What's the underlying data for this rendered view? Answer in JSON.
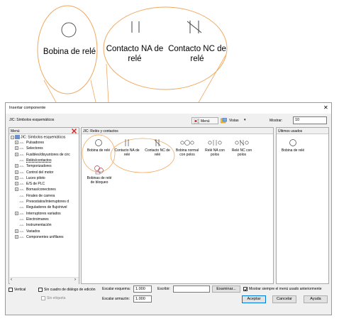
{
  "callouts": {
    "coil": "Bobina de relé",
    "no_contact": "Contacto NA de relé",
    "nc_contact": "Contacto NC de relé"
  },
  "dialog": {
    "title": "Insertar componente",
    "close_glyph": "✕",
    "path_label": "JIC: Símbolos esquemáticos",
    "toolbar": {
      "menu_label": "Menú",
      "views_label": "Vistas",
      "show_label": "Mostrar:",
      "show_value": "10"
    },
    "left_panel": {
      "header": "Menú",
      "root": "JIC: Símbolos esquemáticos",
      "items": [
        {
          "label": "Pulsadores",
          "expandable": true
        },
        {
          "label": "Selectores",
          "expandable": true
        },
        {
          "label": "Fusibles/disyuntores de circ",
          "expandable": true
        },
        {
          "label": "Relés/contactos",
          "expandable": false,
          "selected": true
        },
        {
          "label": "Temporizadores",
          "expandable": true
        },
        {
          "label": "Control del motor",
          "expandable": true
        },
        {
          "label": "Luces piloto",
          "expandable": true
        },
        {
          "label": "E/S de PLC",
          "expandable": true
        },
        {
          "label": "Bornas/conectores",
          "expandable": true
        },
        {
          "label": "Finales de carrera",
          "expandable": false
        },
        {
          "label": "Presostatos/interruptores d",
          "expandable": false
        },
        {
          "label": "Reguladores de flujo/nivel",
          "expandable": false
        },
        {
          "label": "Interruptores variados",
          "expandable": true
        },
        {
          "label": "Electroimanes",
          "expandable": false
        },
        {
          "label": "Instrumentación",
          "expandable": false
        },
        {
          "label": "Variados",
          "expandable": true
        },
        {
          "label": "Componentes unifilares",
          "expandable": true
        }
      ]
    },
    "center_panel": {
      "header": "JIC: Relés y contactos",
      "components": [
        {
          "label": "Bobina de relé",
          "icon": "coil-icon"
        },
        {
          "label": "Contacto NA de relé",
          "icon": "no-contact-icon"
        },
        {
          "label": "Contacto NC de relé",
          "icon": "nc-contact-icon"
        },
        {
          "label": "Bobina normal con polos",
          "icon": "coil-poles-icon"
        },
        {
          "label": "Relé NA con polos",
          "icon": "no-poles-icon"
        },
        {
          "label": "Relé NC con polos",
          "icon": "nc-poles-icon"
        },
        {
          "label": "Bobinas de relé de bloqueo",
          "icon": "latch-coil-icon"
        }
      ]
    },
    "right_panel": {
      "header": "Últimos usados",
      "items": [
        {
          "label": "Bobina de relé"
        }
      ]
    },
    "bottom": {
      "vertical": "Vertical",
      "no_edit_dialog": "Sin cuadro de diálogo de edición",
      "no_tags": "Sin etiqueta",
      "scale_schematic_label": "Escalar esquema:",
      "scale_schematic_value": "1.000",
      "scale_frame_label": "Escalar armazón:",
      "scale_frame_value": "1.000",
      "write_label": "Escribir:",
      "write_value": "",
      "browse_button": "Examinar...",
      "always_show_menu": "Mostrar siempre el menú usado anteriormente",
      "accept": "Aceptar",
      "cancel": "Cancelar",
      "help": "Ayuda"
    }
  }
}
